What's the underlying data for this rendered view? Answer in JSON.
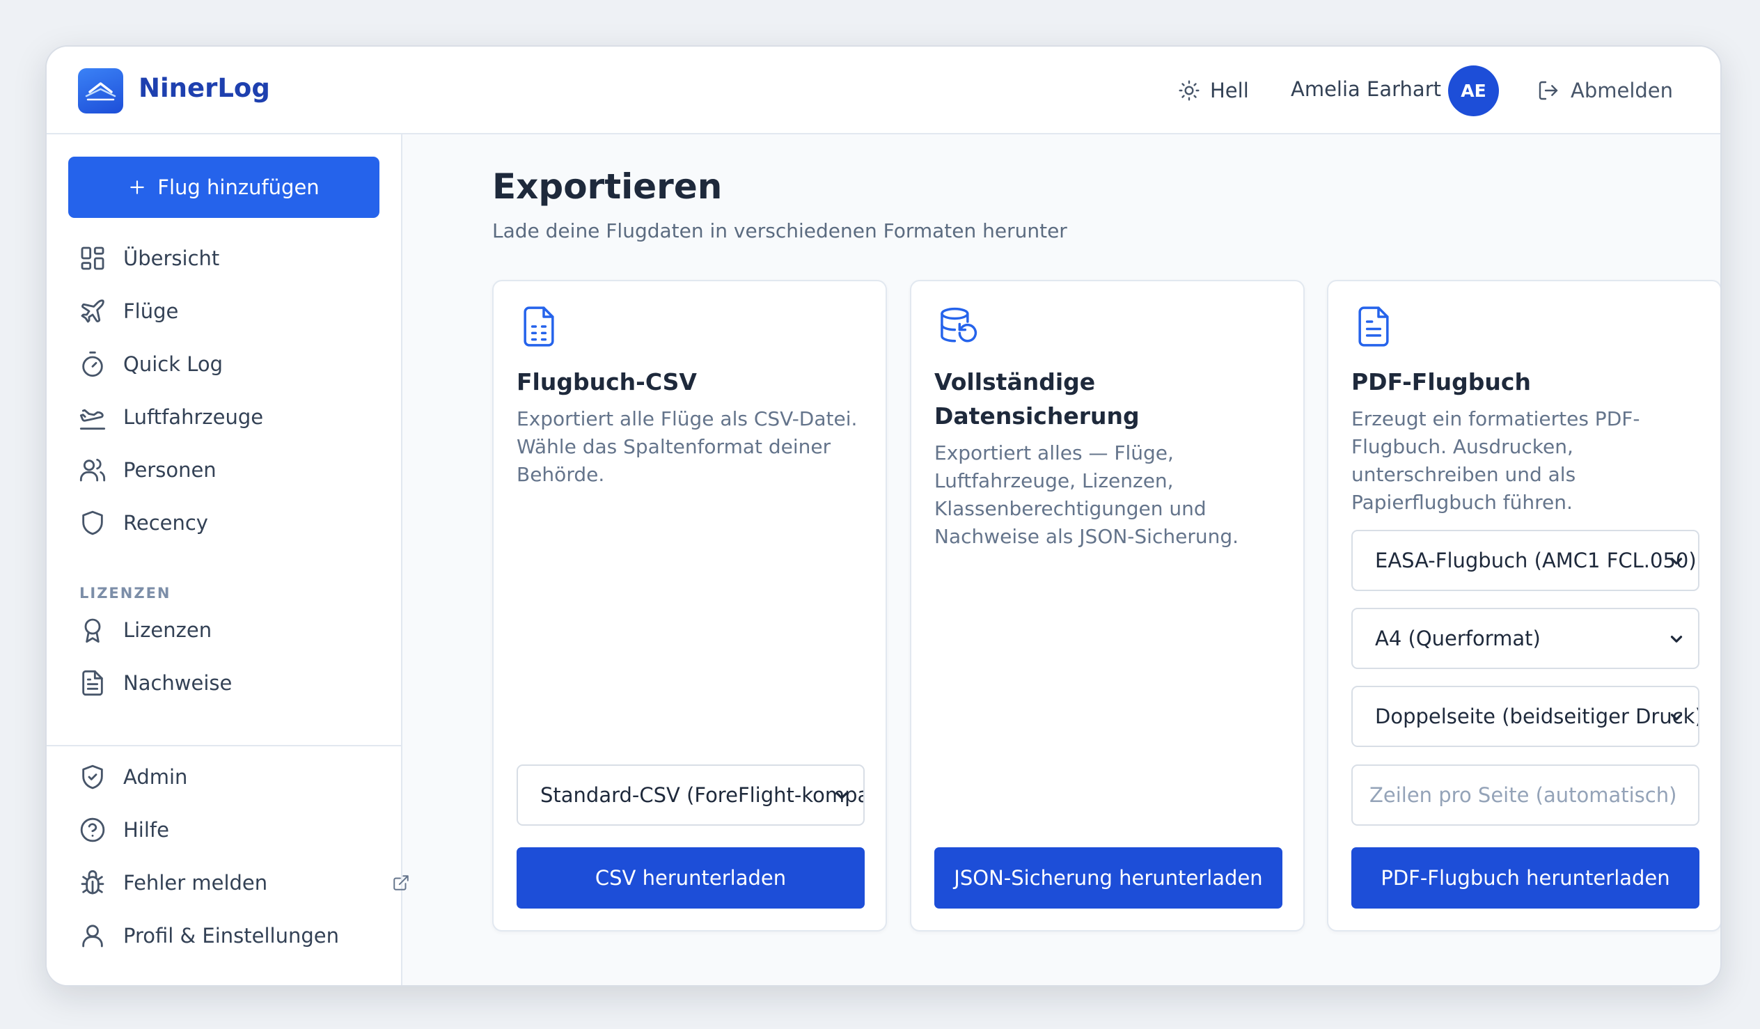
{
  "app": {
    "brand": "NinerLog",
    "theme_label": "Hell",
    "user_name": "Amelia Earhart",
    "user_initials": "AE",
    "logout_label": "Abmelden"
  },
  "sidebar": {
    "add_flight_label": "Flug hinzufügen",
    "main_items": [
      {
        "label": "Übersicht",
        "icon": "dashboard-icon"
      },
      {
        "label": "Flüge",
        "icon": "plane-icon"
      },
      {
        "label": "Quick Log",
        "icon": "stopwatch-icon"
      },
      {
        "label": "Luftfahrzeuge",
        "icon": "plane-landing-icon"
      },
      {
        "label": "Personen",
        "icon": "users-icon"
      },
      {
        "label": "Recency",
        "icon": "shield-icon"
      }
    ],
    "section_label": "LIZENZEN",
    "license_items": [
      {
        "label": "Lizenzen",
        "icon": "award-icon"
      },
      {
        "label": "Nachweise",
        "icon": "document-icon"
      }
    ],
    "bottom_items": [
      {
        "label": "Admin",
        "icon": "shield-check-icon"
      },
      {
        "label": "Hilfe",
        "icon": "help-circle-icon"
      },
      {
        "label": "Fehler melden",
        "icon": "bug-icon"
      },
      {
        "label": "Profil & Einstellungen",
        "icon": "user-icon"
      }
    ]
  },
  "main": {
    "title": "Exportieren",
    "subtitle": "Lade deine Flugdaten in verschiedenen Formaten herunter",
    "cards": [
      {
        "icon": "csv-file-icon",
        "title": "Flugbuch-CSV",
        "description": "Exportiert alle Flüge als CSV-Datei. Wähle das Spaltenformat deiner Behörde.",
        "select_value": "Standard-CSV (ForeFlight-kompatibel)",
        "button_label": "CSV herunterladen"
      },
      {
        "icon": "database-restore-icon",
        "title": "Vollständige Datensicherung",
        "description": "Exportiert alles — Flüge, Luftfahrzeuge, Lizenzen, Klassenberechtigungen und Nachweise als JSON-Sicherung.",
        "button_label": "JSON-Sicherung herunterladen"
      },
      {
        "icon": "pdf-file-icon",
        "title": "PDF-Flugbuch",
        "description": "Erzeugt ein formatiertes PDF-Flugbuch. Ausdrucken, unterschreiben und als Papierflugbuch führen.",
        "format_select": "EASA-Flugbuch (AMC1 FCL.050)",
        "paper_select": "A4 (Querformat)",
        "layout_select": "Doppelseite (beidseitiger Druck)",
        "rows_placeholder": "Zeilen pro Seite (automatisch)",
        "button_label": "PDF-Flugbuch herunterladen"
      }
    ]
  },
  "colors": {
    "primary": "#2563eb",
    "primary_dark": "#1d4ed8",
    "brand_text": "#1e40af"
  }
}
